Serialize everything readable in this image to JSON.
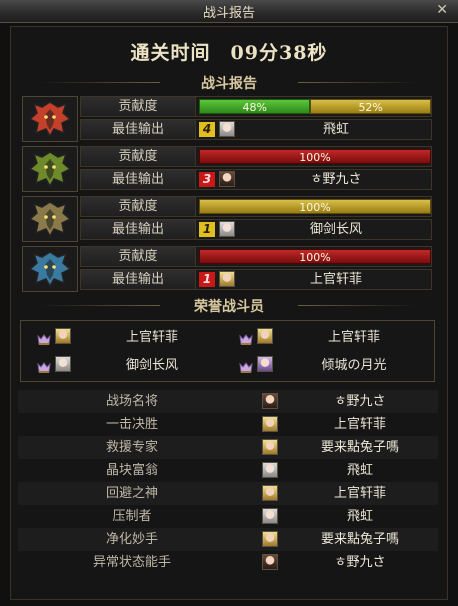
{
  "window": {
    "title": "战斗报告",
    "close_glyph": "✕"
  },
  "clear_time": "通关时间　09分38秒",
  "sections": {
    "report": "战斗报告",
    "honor": "荣誉战斗员"
  },
  "labels": {
    "contribution": "贡献度",
    "best_output": "最佳输出"
  },
  "teams": [
    {
      "emblem": "red-dragon-emblem-icon",
      "emblem_color": "#c4402a",
      "contribution": [
        {
          "label": "48%",
          "value": 48,
          "color": "green"
        },
        {
          "label": "52%",
          "value": 52,
          "color": "gold"
        }
      ],
      "best_rank": "4",
      "rank_color": "gold",
      "best_name": "飛虹",
      "avatar": "w"
    },
    {
      "emblem": "green-dragon-emblem-icon",
      "emblem_color": "#6e8a2a",
      "contribution": [
        {
          "label": "100%",
          "value": 100,
          "color": "red"
        }
      ],
      "best_rank": "3",
      "rank_color": "red",
      "best_name": "ㅎ野九さ",
      "avatar": "d"
    },
    {
      "emblem": "gold-dragon-emblem-icon",
      "emblem_color": "#8a7a4a",
      "contribution": [
        {
          "label": "100%",
          "value": 100,
          "color": "gold"
        }
      ],
      "best_rank": "1",
      "rank_color": "gold",
      "best_name": "御剑长风",
      "avatar": "w"
    },
    {
      "emblem": "blue-dragon-emblem-icon",
      "emblem_color": "#3a7aa0",
      "contribution": [
        {
          "label": "100%",
          "value": 100,
          "color": "red"
        }
      ],
      "best_rank": "1",
      "rank_color": "red",
      "best_name": "上官轩菲",
      "avatar": "b"
    }
  ],
  "honor_members": [
    {
      "name": "上官轩菲",
      "avatar": "b",
      "medal": "honor-medal-icon"
    },
    {
      "name": "上官轩菲",
      "avatar": "b",
      "medal": "honor-medal-icon"
    },
    {
      "name": "御剑长风",
      "avatar": "w",
      "medal": "honor-medal-icon"
    },
    {
      "name": "倾城の月光",
      "avatar": "p",
      "medal": "honor-medal-icon"
    }
  ],
  "awards": [
    {
      "title": "战场名将",
      "player": "ㅎ野九さ",
      "avatar": "d"
    },
    {
      "title": "一击决胜",
      "player": "上官轩菲",
      "avatar": "b"
    },
    {
      "title": "救援专家",
      "player": "要来點兔子嗎",
      "avatar": "b"
    },
    {
      "title": "晶块富翁",
      "player": "飛虹",
      "avatar": "w"
    },
    {
      "title": "回避之神",
      "player": "上官轩菲",
      "avatar": "b"
    },
    {
      "title": "压制者",
      "player": "飛虹",
      "avatar": "w"
    },
    {
      "title": "净化妙手",
      "player": "要来點兔子嗎",
      "avatar": "b"
    },
    {
      "title": "异常状态能手",
      "player": "ㅎ野九さ",
      "avatar": "d"
    }
  ]
}
